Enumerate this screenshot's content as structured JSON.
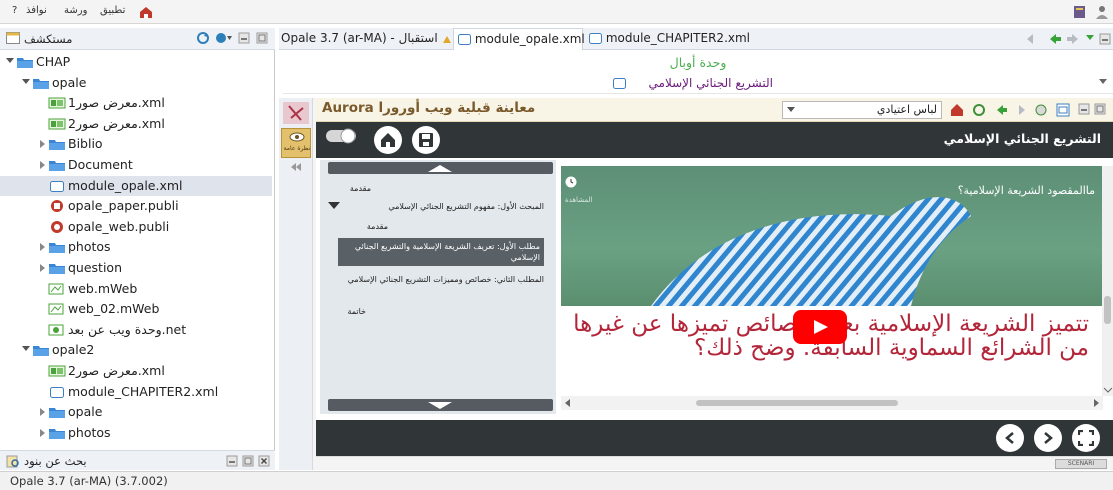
{
  "menubar": {
    "items": [
      "?",
      "نوافذ",
      "ورشة",
      "تطبيق"
    ]
  },
  "explorer": {
    "title": "مستكشف",
    "tree": [
      {
        "label": "CHAP",
        "icon": "folder-icon",
        "indent": 0,
        "twisty": "open"
      },
      {
        "label": "opale",
        "icon": "folder-icon",
        "indent": 1,
        "twisty": "open"
      },
      {
        "label": "معرض صور1.xml",
        "icon": "gallery-icon",
        "indent": 2,
        "twisty": "none"
      },
      {
        "label": "معرض صور2.xml",
        "icon": "gallery-icon",
        "indent": 2,
        "twisty": "none"
      },
      {
        "label": "Biblio",
        "icon": "folder-icon",
        "indent": 2,
        "twisty": "closed"
      },
      {
        "label": "Document",
        "icon": "folder-icon",
        "indent": 2,
        "twisty": "closed"
      },
      {
        "label": "module_opale.xml",
        "icon": "module-icon",
        "indent": 2,
        "twisty": "none",
        "selected": true
      },
      {
        "label": "opale_paper.publi",
        "icon": "paper-publi-icon",
        "indent": 2,
        "twisty": "none"
      },
      {
        "label": "opale_web.publi",
        "icon": "web-publi-icon",
        "indent": 2,
        "twisty": "none"
      },
      {
        "label": "photos",
        "icon": "folder-icon",
        "indent": 2,
        "twisty": "closed"
      },
      {
        "label": "question",
        "icon": "folder-icon",
        "indent": 2,
        "twisty": "closed"
      },
      {
        "label": "web.mWeb",
        "icon": "mweb-icon",
        "indent": 2,
        "twisty": "none"
      },
      {
        "label": "web_02.mWeb",
        "icon": "mweb-icon",
        "indent": 2,
        "twisty": "none"
      },
      {
        "label": "وحدة ويب عن بعد.net",
        "icon": "net-icon",
        "indent": 2,
        "twisty": "none"
      },
      {
        "label": "opale2",
        "icon": "folder-icon",
        "indent": 1,
        "twisty": "open"
      },
      {
        "label": "معرض صور2.xml",
        "icon": "gallery-icon",
        "indent": 2,
        "twisty": "none"
      },
      {
        "label": "module_CHAPITER2.xml",
        "icon": "module-icon",
        "indent": 2,
        "twisty": "none"
      },
      {
        "label": "opale",
        "icon": "folder-icon",
        "indent": 2,
        "twisty": "closed"
      },
      {
        "label": "photos",
        "icon": "folder-icon",
        "indent": 2,
        "twisty": "closed"
      }
    ],
    "search_label": "بحث عن بنود"
  },
  "tabs": [
    {
      "label": "Opale 3.7 (ar-MA) - استقبال",
      "active": false
    },
    {
      "label": "module_opale.xml",
      "active": true
    },
    {
      "label": "module_CHAPITER2.xml",
      "active": false
    }
  ],
  "editor": {
    "unit_title": "وحدة أوبال",
    "chapter_title": "التشريع الجنائي الإسلامي"
  },
  "left_strip": {
    "overview_label": "نظرة عامة"
  },
  "preview": {
    "title": "Aurora معاينة قبلية ويب أورورا",
    "skin": "لباس اعتيادي",
    "site_title": "التشريع الجنائي الإسلامي",
    "menu": [
      {
        "label": "مقدمة",
        "style": "plain"
      },
      {
        "label": "المبحث الأول: مفهوم التشريع الجنائي الإسلامي",
        "style": "expanded"
      },
      {
        "label": "مقدمة",
        "style": "plain-sub"
      },
      {
        "label": "مطلب الأول: تعريف الشريعة الإسلامية والتشريع الجنائي الإسلامي",
        "style": "boxed"
      },
      {
        "label": "المطلب الثاني: خصائص ومميزات التشريع الجنائي الإسلامي",
        "style": "plain-sub"
      },
      {
        "label": "خاتمة",
        "style": "plain"
      }
    ],
    "video": {
      "question": "ماالمقصود الشريعة الإسلامية؟",
      "watermark": "المشاهدة",
      "slide_text": "تتميز الشريعة الإسلامية بعدة خصائص تميزها عن غيرها من الشرائع السماوية السابقة. وضح ذلك؟"
    },
    "footer_badge": "SCENARI"
  },
  "status": {
    "text": "Opale 3.7 (ar-MA) (3.7.002)"
  },
  "colors": {
    "accent_green": "#4caf50",
    "site_dark": "#303638",
    "video_red_text": "#b3263a",
    "youtube_red": "#ff0000"
  }
}
